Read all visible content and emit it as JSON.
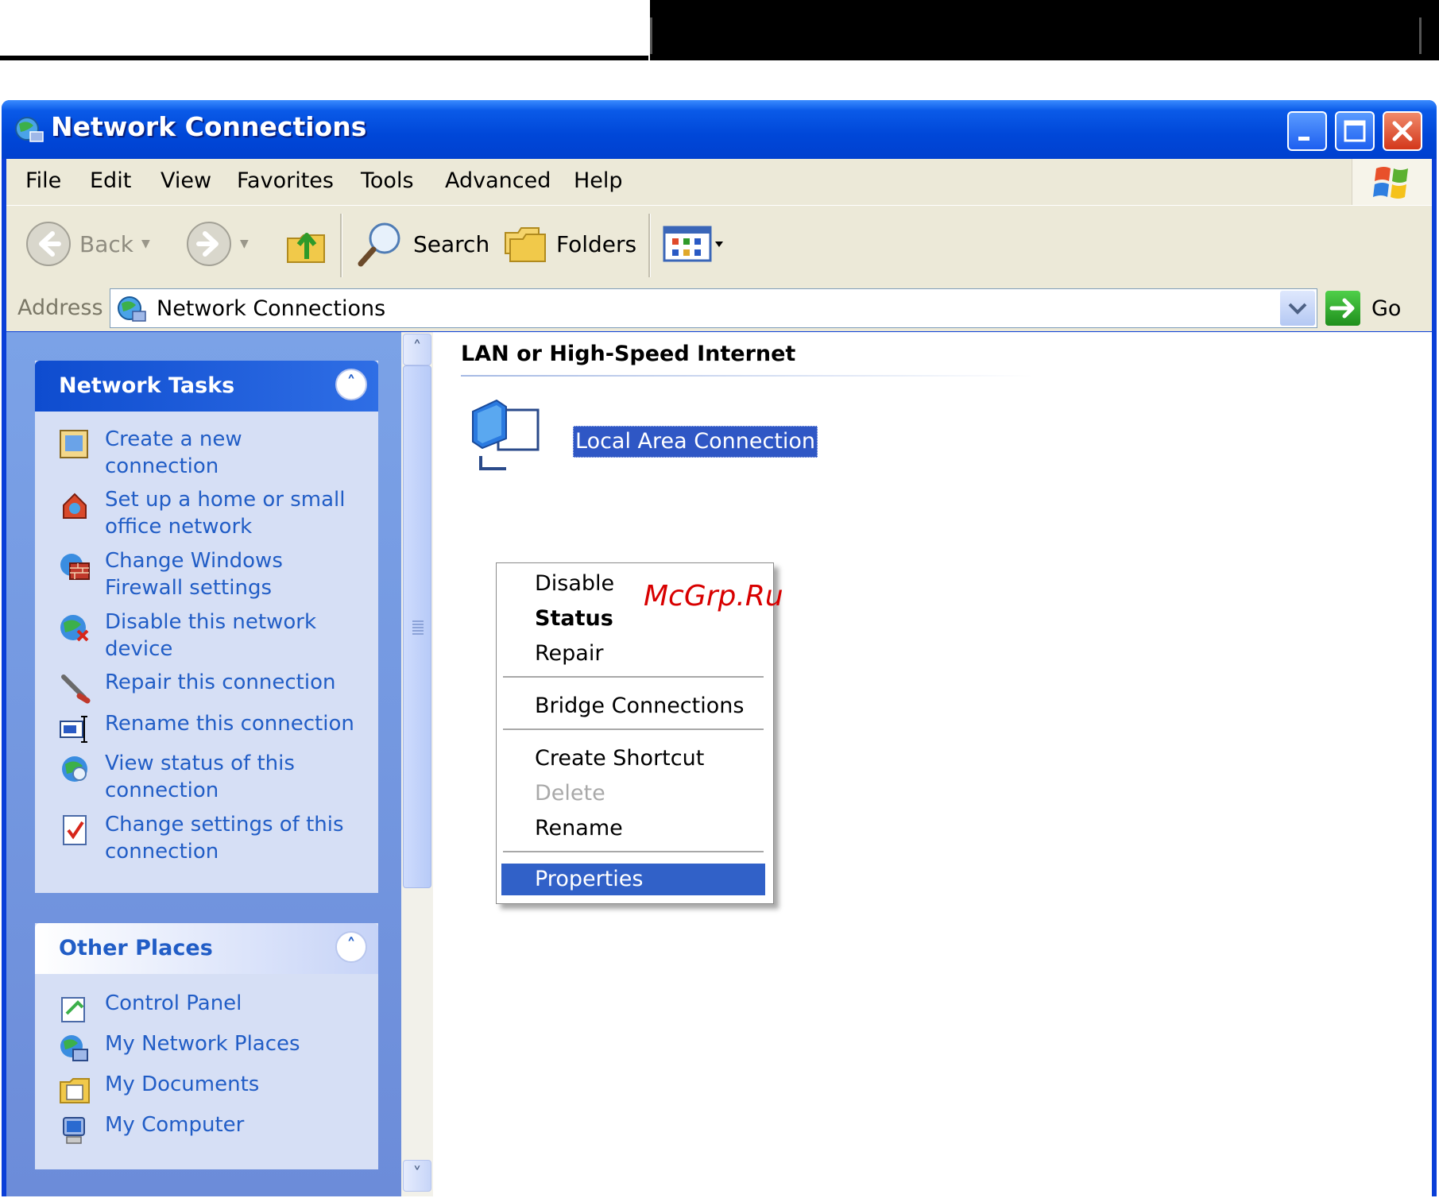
{
  "window": {
    "title": "Network Connections"
  },
  "menubar": {
    "items": [
      "File",
      "Edit",
      "View",
      "Favorites",
      "Tools",
      "Advanced",
      "Help"
    ]
  },
  "toolbar": {
    "back_label": "Back",
    "search_label": "Search",
    "folders_label": "Folders"
  },
  "address": {
    "label": "Address",
    "value": "Network Connections",
    "go_label": "Go"
  },
  "task_pane": {
    "network_tasks": {
      "title": "Network Tasks",
      "items": [
        {
          "label": "Create a new connection",
          "icon": "new-connection-icon"
        },
        {
          "label": "Set up a home or small office network",
          "icon": "home-network-icon"
        },
        {
          "label": "Change Windows Firewall settings",
          "icon": "firewall-icon"
        },
        {
          "label": "Disable this network device",
          "icon": "disable-network-icon"
        },
        {
          "label": "Repair this connection",
          "icon": "repair-icon"
        },
        {
          "label": "Rename this connection",
          "icon": "rename-icon"
        },
        {
          "label": "View status of this connection",
          "icon": "status-icon"
        },
        {
          "label": "Change settings of this connection",
          "icon": "settings-icon"
        }
      ]
    },
    "other_places": {
      "title": "Other Places",
      "items": [
        {
          "label": "Control Panel",
          "icon": "control-panel-icon"
        },
        {
          "label": "My Network Places",
          "icon": "network-places-icon"
        },
        {
          "label": "My Documents",
          "icon": "documents-icon"
        },
        {
          "label": "My Computer",
          "icon": "computer-icon"
        }
      ]
    }
  },
  "content": {
    "group_header": "LAN or High-Speed Internet",
    "connection_label": "Local Area Connection"
  },
  "context_menu": {
    "items": [
      {
        "label": "Disable",
        "state": "normal"
      },
      {
        "label": "Status",
        "state": "default"
      },
      {
        "label": "Repair",
        "state": "normal"
      },
      {
        "label": "Bridge Connections",
        "state": "normal"
      },
      {
        "label": "Create Shortcut",
        "state": "normal"
      },
      {
        "label": "Delete",
        "state": "disabled"
      },
      {
        "label": "Rename",
        "state": "normal"
      },
      {
        "label": "Properties",
        "state": "selected"
      }
    ]
  },
  "watermark": "McGrp.Ru",
  "colors": {
    "title_bar": "#0047d8",
    "task_link": "#215dc6",
    "selection": "#3161c8",
    "watermark": "#d80000"
  }
}
